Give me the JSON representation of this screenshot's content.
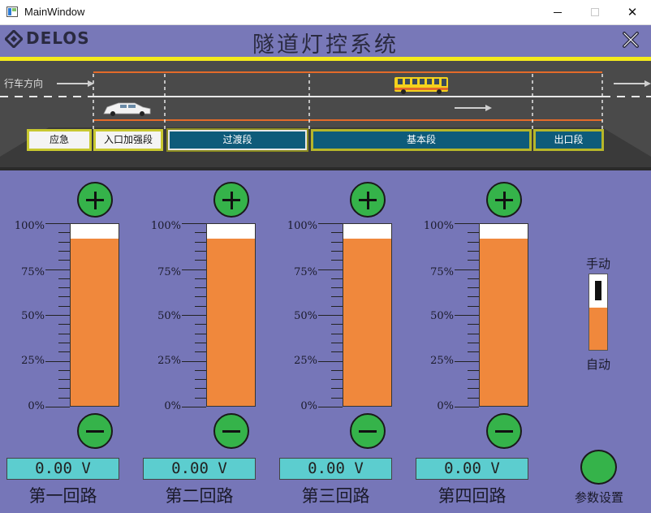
{
  "window": {
    "title": "MainWindow",
    "minimize_label": "",
    "maximize_label": "",
    "close_label": "✕"
  },
  "header": {
    "logo_text": "DELOS",
    "title": "隧道灯控系统"
  },
  "road": {
    "direction_label": "行车方向",
    "segments": [
      {
        "label": "应急"
      },
      {
        "label": "入口加强段"
      },
      {
        "label": "过渡段"
      },
      {
        "label": "基本段"
      },
      {
        "label": "出口段"
      }
    ]
  },
  "scale": {
    "labels": [
      "100%",
      "75%",
      "50%",
      "25%",
      "0%"
    ]
  },
  "channels": [
    {
      "name": "第一回路",
      "voltage": "0.00 V",
      "level_percent": 92
    },
    {
      "name": "第二回路",
      "voltage": "0.00 V",
      "level_percent": 92
    },
    {
      "name": "第三回路",
      "voltage": "0.00 V",
      "level_percent": 92
    },
    {
      "name": "第四回路",
      "voltage": "0.00 V",
      "level_percent": 92
    }
  ],
  "mode": {
    "manual_label": "手动",
    "auto_label": "自动"
  },
  "settings": {
    "label": "参数设置"
  },
  "colors": {
    "background": "#7676b8",
    "accent_yellow": "#f4ea1c",
    "bar_orange": "#f0883c",
    "button_green": "#35b34a",
    "voltage_cyan": "#5ccdcf",
    "segment_blue": "#0e5b7a"
  }
}
